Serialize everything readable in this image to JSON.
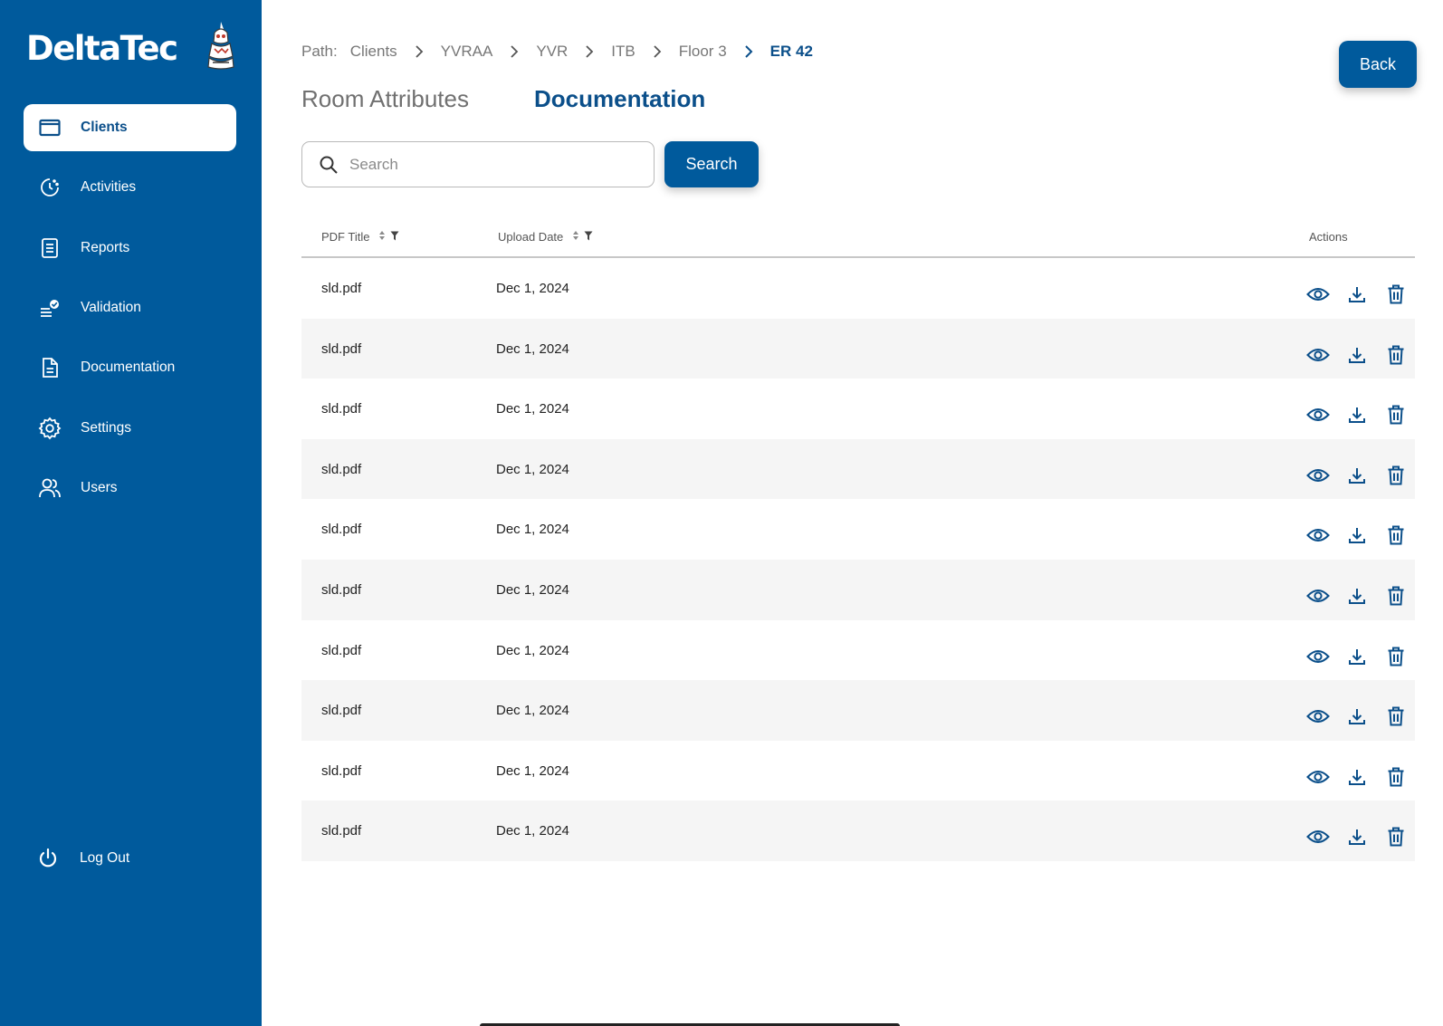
{
  "brand": {
    "name": "DeltaTec",
    "logo_icon": "totem-logo-icon"
  },
  "colors": {
    "sidebar": "#005a9c",
    "accent": "#0b4f8a",
    "row_alt": "#f5f5f5"
  },
  "sidebar": {
    "items": [
      {
        "label": "Clients",
        "icon": "window-icon",
        "active": true
      },
      {
        "label": "Activities",
        "icon": "activity-clock-icon",
        "active": false
      },
      {
        "label": "Reports",
        "icon": "report-icon",
        "active": false
      },
      {
        "label": "Validation",
        "icon": "validation-check-icon",
        "active": false
      },
      {
        "label": "Documentation",
        "icon": "document-icon",
        "active": false
      },
      {
        "label": "Settings",
        "icon": "gear-icon",
        "active": false
      },
      {
        "label": "Users",
        "icon": "users-icon",
        "active": false
      }
    ],
    "logout_label": "Log Out"
  },
  "breadcrumb": {
    "prefix": "Path:",
    "items": [
      "Clients",
      "YVRAA",
      "YVR",
      "ITB",
      "Floor 3"
    ],
    "current": "ER 42"
  },
  "back_label": "Back",
  "tabs": {
    "room": "Room Attributes",
    "documentation": "Documentation",
    "active": "documentation"
  },
  "search": {
    "placeholder": "Search",
    "value": "",
    "button_label": "Search"
  },
  "table": {
    "columns": {
      "title": "PDF Title",
      "date": "Upload Date",
      "actions": "Actions"
    },
    "rows": [
      {
        "title": "sld.pdf",
        "date": "Dec 1, 2024"
      },
      {
        "title": "sld.pdf",
        "date": "Dec 1, 2024"
      },
      {
        "title": "sld.pdf",
        "date": "Dec 1, 2024"
      },
      {
        "title": "sld.pdf",
        "date": "Dec 1, 2024"
      },
      {
        "title": "sld.pdf",
        "date": "Dec 1, 2024"
      },
      {
        "title": "sld.pdf",
        "date": "Dec 1, 2024"
      },
      {
        "title": "sld.pdf",
        "date": "Dec 1, 2024"
      },
      {
        "title": "sld.pdf",
        "date": "Dec 1, 2024"
      },
      {
        "title": "sld.pdf",
        "date": "Dec 1, 2024"
      },
      {
        "title": "sld.pdf",
        "date": "Dec 1, 2024"
      }
    ],
    "row_actions": [
      "eye-icon",
      "download-icon",
      "trash-icon"
    ]
  }
}
